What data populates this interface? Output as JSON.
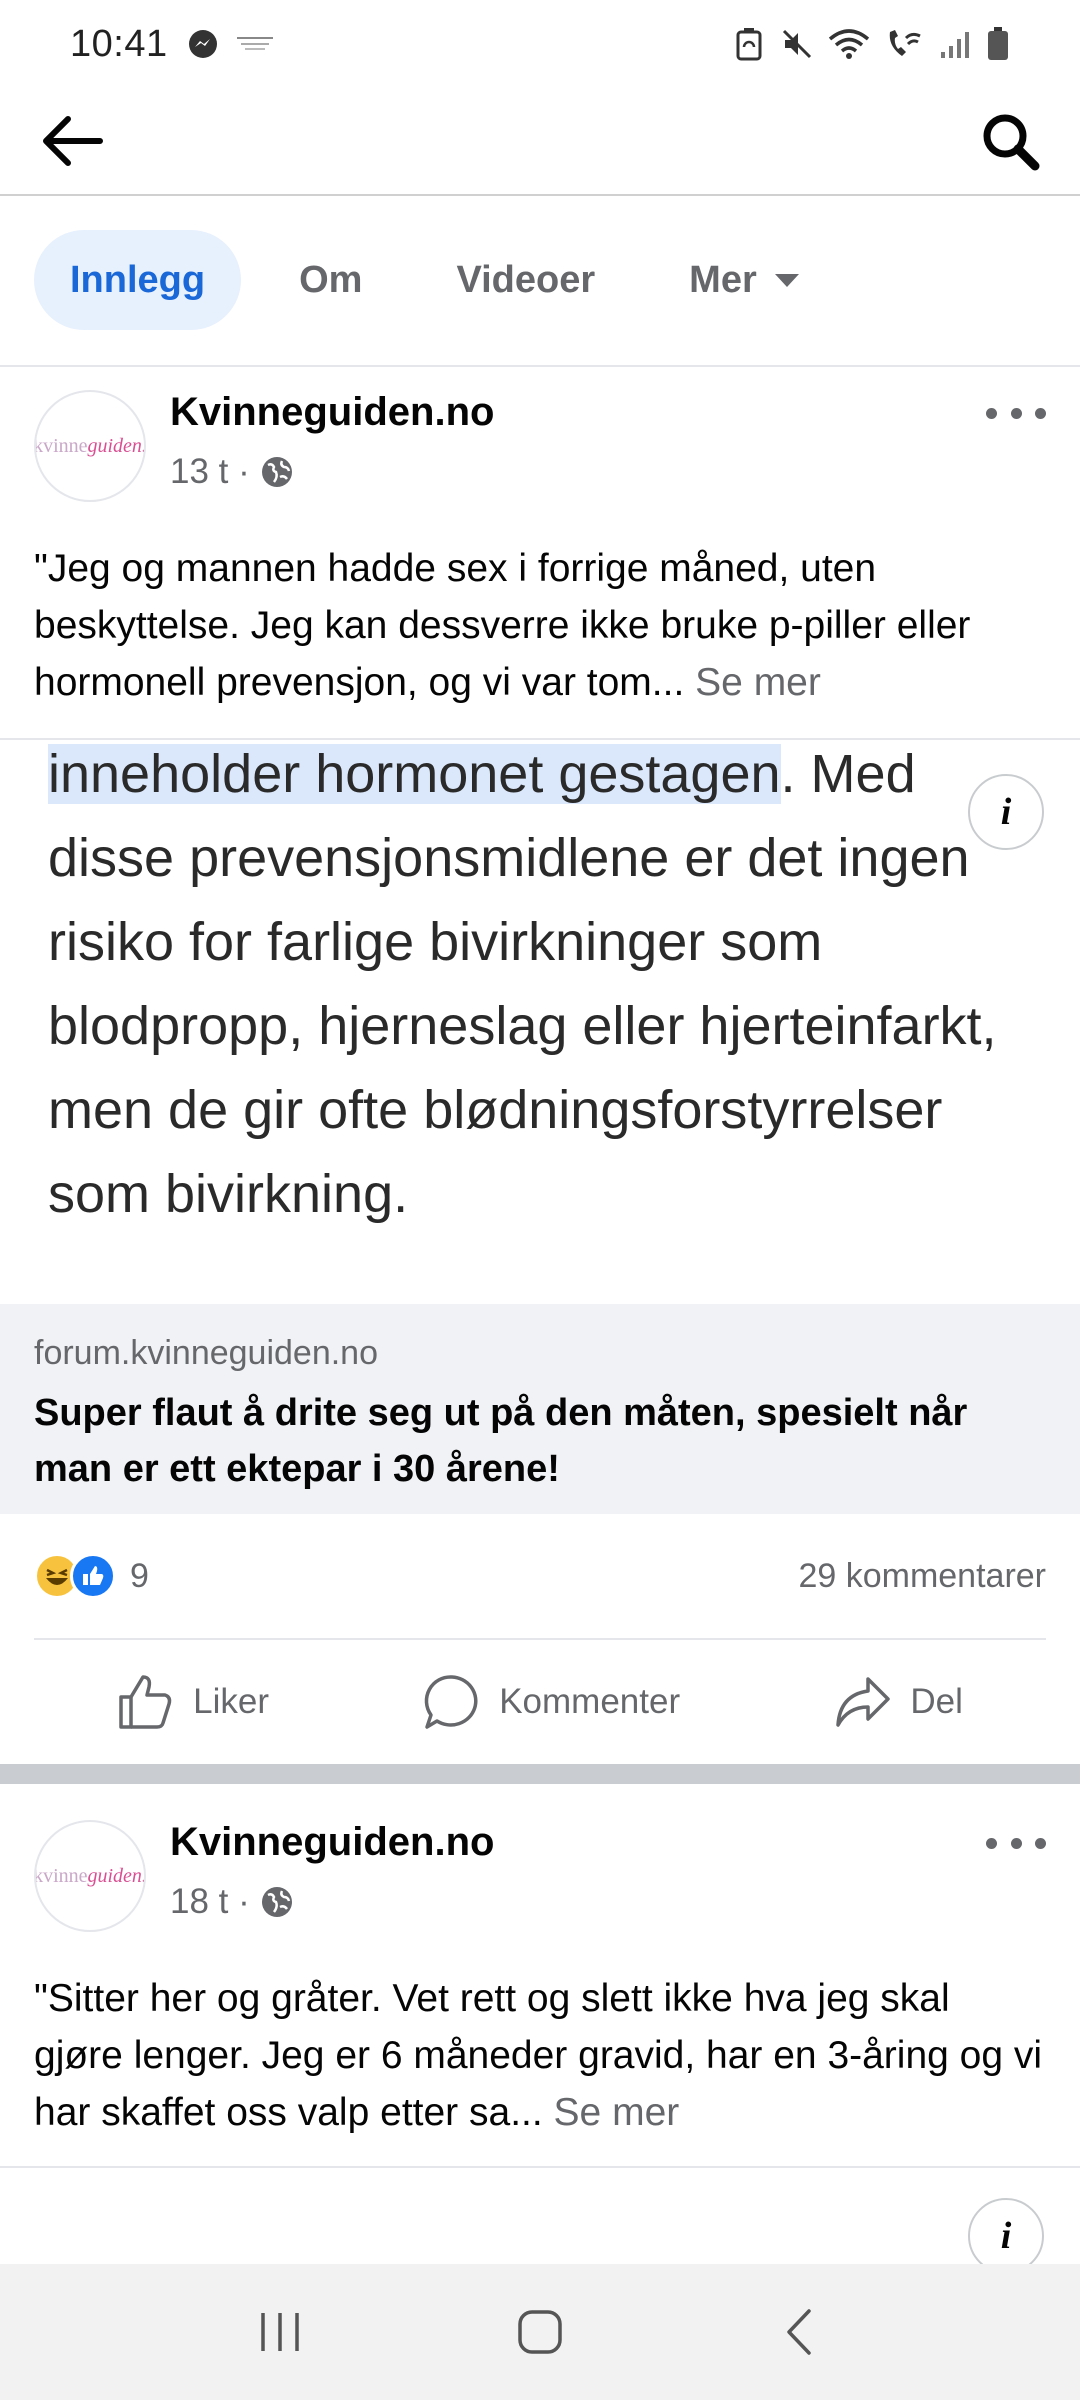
{
  "status_bar": {
    "time": "10:41",
    "left_icons": [
      "messenger-icon",
      "notification-thumbnail-icon"
    ],
    "right_icons": [
      "battery-saver-icon",
      "mute-icon",
      "wifi-icon",
      "wifi-calling-icon",
      "signal-icon",
      "battery-icon"
    ]
  },
  "app_bar": {
    "back_icon": "arrow-left-icon",
    "search_icon": "search-icon"
  },
  "tabs": [
    {
      "label": "Innlegg",
      "active": true
    },
    {
      "label": "Om",
      "active": false
    },
    {
      "label": "Videoer",
      "active": false
    },
    {
      "label": "Mer",
      "active": false,
      "has_dropdown": true
    }
  ],
  "posts": [
    {
      "page_name": "Kvinneguiden.no",
      "avatar_logo": {
        "part1": "kvinne",
        "part2": "guiden."
      },
      "time": "13 t ·",
      "audience_icon": "globe-icon",
      "text": "\"Jeg og mannen hadde sex i forrige måned, uten beskyttelse. Jeg kan dessverre ikke bruke p-piller eller hormonell prevensjon, og vi var tom...",
      "see_more": "Se mer",
      "image_text": {
        "highlighted": "inneholder hormonet gestagen",
        "rest": ". Med disse prevensjonsmidlene er det ingen risiko for farlige bivirkninger som blodpropp, hjerneslag eller hjerteinfarkt, men de gir ofte blødningsforstyrrelser som bivirkning."
      },
      "info_label": "i",
      "link": {
        "domain": "forum.kvinneguiden.no",
        "title": "Super flaut å drite seg ut på den måten, spesielt når man er ett ektepar i 30 årene!"
      },
      "reaction_count": "9",
      "reaction_types": [
        "haha-reaction-icon",
        "like-reaction-icon"
      ],
      "comments": "29 kommentarer",
      "actions": {
        "like": "Liker",
        "comment": "Kommenter",
        "share": "Del"
      }
    },
    {
      "page_name": "Kvinneguiden.no",
      "avatar_logo": {
        "part1": "kvinne",
        "part2": "guiden."
      },
      "time": "18 t ·",
      "audience_icon": "globe-icon",
      "text": "\"Sitter her og gråter. Vet rett og slett ikke hva jeg skal gjøre lenger. Jeg er 6 måneder gravid, har en 3-åring og vi har skaffet oss valp etter sa...",
      "see_more": "Se mer",
      "info_label": "i"
    }
  ],
  "nav_bar": [
    "recents-icon",
    "home-icon",
    "back-icon"
  ],
  "colors": {
    "accent": "#1a68d8",
    "tab_active_bg": "#e7f0fd",
    "secondary_text": "#65676b",
    "link_bg": "#f0f2f5"
  }
}
